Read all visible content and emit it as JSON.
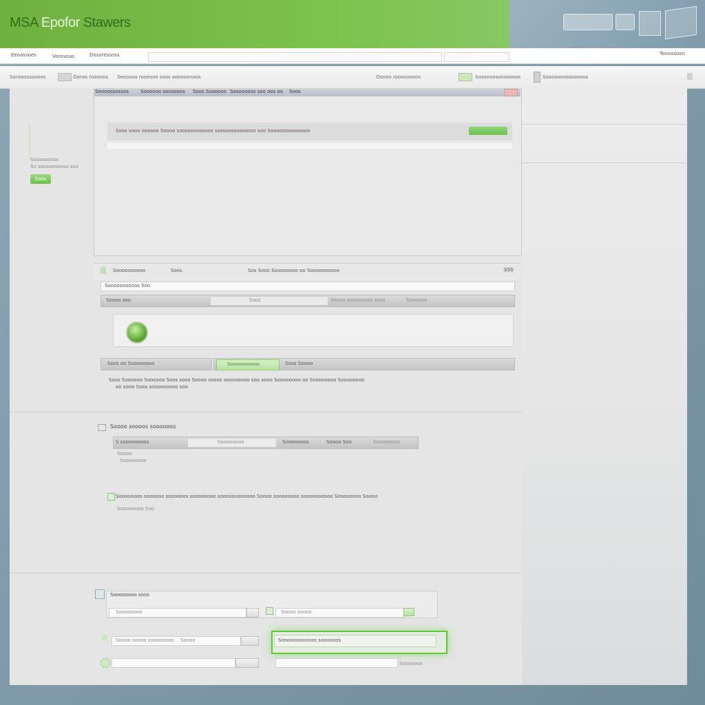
{
  "header": {
    "title_part1": "MSA",
    "title_part2": "Epofor",
    "title_part3": "Stawers"
  },
  "menu": {
    "items": [
      "Eeoassoes",
      "Vorovoas",
      "Dosoressoss"
    ],
    "right_link": "Tonoosoon"
  },
  "toolbar": {
    "items": [
      "Soroooossooes",
      "Ooroo rooooos",
      "Seoosoo rooesoo soos ooosoonoos",
      "Ooooo roosooooos",
      "Sosoooosoosoooos"
    ]
  },
  "inner_window": {
    "tabs": [
      "Seoooosossos",
      "Soooooo soosooos",
      "Soos Soooooo",
      "Sosooooos soo oos oo",
      "Soos"
    ],
    "row_text": "Soos sooo ooosoo Soooo soosoooossooo ssossoosoooosso soo Soooooossoossoo"
  },
  "left_panel": {
    "lines": [
      "Sosoooooss",
      "So soosoooooss soo"
    ],
    "button_label": "Soos"
  },
  "section1": {
    "label1": "Soooooooooo",
    "label2": "Soos",
    "label3": "Sos Sooo Soooooooo oo Soooooooooo",
    "right_badge": "SSS",
    "filter_text": "Soooooooooos Soo",
    "row_label": "Soooo soo",
    "row_field": "Soos",
    "row_right": "Soooo soooooooo soos",
    "row_right2": "Soooooo"
  },
  "section2": {
    "left_label": "Soos oo Soooooooo",
    "green_field_text": "Soooooooooo",
    "right_text": "Soos Soooo",
    "desc_line1": "Soos Soooooo Soooooo Soos soos Soooo sooos soooooooo soo sooo Soooooooo oo Soooooooo Soooooooo",
    "desc_line2": "oo sooo Soos sooooooooo soo"
  },
  "section3": {
    "title": "Soooo soooos soooooos",
    "field_label": "S soooooooos",
    "mid_label": "Soooooooo",
    "right_label": "Soooooooo",
    "right_label2": "Soooo Soo",
    "far_right": "Soooooooo",
    "sub1": "Soooo",
    "sub2": "Soooooooo",
    "desc_line1": "Soooooooo soooooo soooooos soooooooo soooooooooooo Soooo soooooooo soooooooooo Soooooooo Soooo",
    "desc_line2": "Soooooooo Soo"
  },
  "section4": {
    "title": "Soooooooo soos",
    "field1": "Soooooooo",
    "field2": "Soooo soooo",
    "field3": "Soooo soooo soooooooo",
    "field3b": "Soooo",
    "highlight_field": "Soooooooooooo soooooos",
    "bottom_right": "Soooooos"
  },
  "colors": {
    "brand_green": "#6fb13f",
    "highlight_green": "#63c53a"
  }
}
